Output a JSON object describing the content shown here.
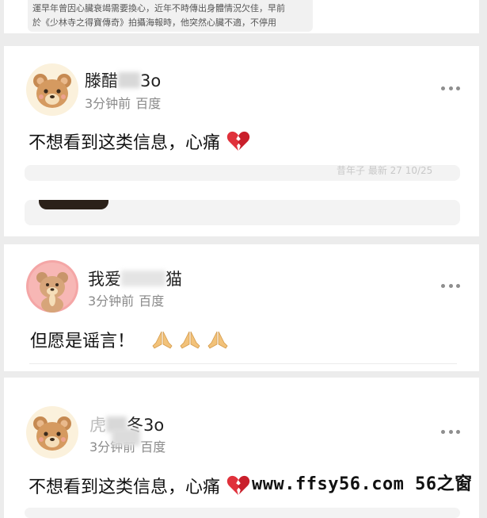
{
  "top_snippet": {
    "line1": "運早年曾因心臟衰竭需要換心，近年不時傳出身體情況欠佳，早前",
    "line2": "於《少林寺之得寶傳奇》拍攝海報時，他突然心臟不適，不停用"
  },
  "comments": [
    {
      "username": "滕醋",
      "username_suffix": "3o",
      "time": "3分钟前",
      "source": "百度",
      "text": "不想看到这类信息，心痛",
      "emoji": "broken-heart",
      "faded_meta": "昔年子 最新 27 10/25"
    },
    {
      "username": "我爱",
      "username_suffix": "猫",
      "time": "3分钟前",
      "source": "百度",
      "text": "但愿是谣言！",
      "emoji": "praying-hands"
    },
    {
      "username": "虎",
      "username_suffix": "冬3o",
      "time": "3分钟前",
      "source": "百度",
      "text": "不想看到这类信息，心痛",
      "emoji": "broken-heart"
    }
  ],
  "watermark": "www.ffsy56.com 56之窗",
  "colors": {
    "background": "#ececec",
    "card": "#ffffff",
    "meta_gray": "#8a8a8a",
    "heart_red": "#e0313b",
    "avatar_bg": "#fbf1dc",
    "avatar_pink_bg": "#f4a6a6"
  }
}
